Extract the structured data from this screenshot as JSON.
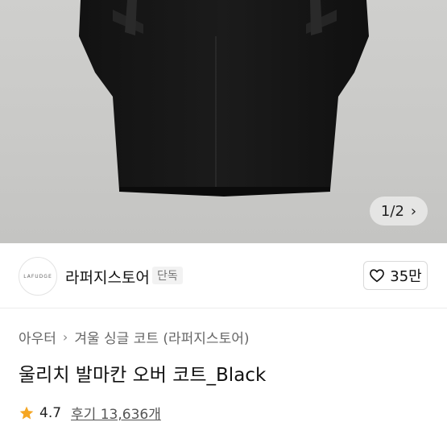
{
  "gallery": {
    "current": "1",
    "separator": "/",
    "total": "2",
    "next_icon": "chevron-right-icon"
  },
  "store": {
    "logo_text": "LAFUDGE",
    "name": "라퍼지스토어",
    "badge": "단독",
    "likes_label": "35만",
    "like_icon": "heart-outline-icon"
  },
  "product": {
    "breadcrumb": [
      "아우터",
      "겨울 싱글 코트 (라퍼지스토어)"
    ],
    "breadcrumb_sep_icon": "chevron-right-icon",
    "title": "울리치 발마칸 오버 코트_Black",
    "rating": "4.7",
    "star_icon": "star-icon",
    "star_color": "#f5a623",
    "reviews": "후기 13,636개"
  }
}
